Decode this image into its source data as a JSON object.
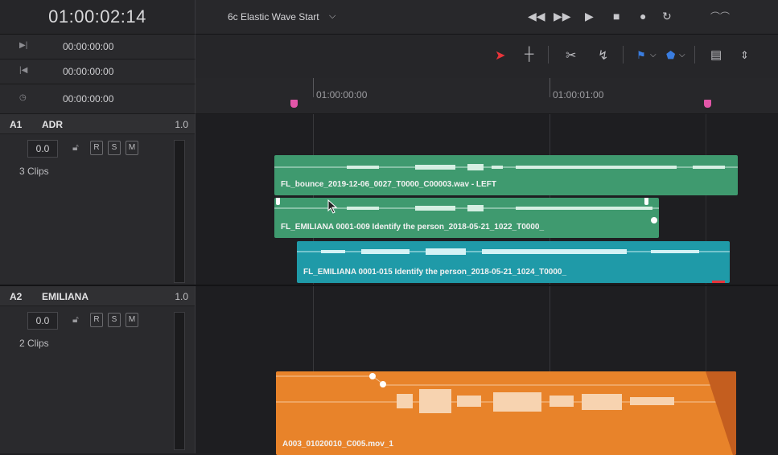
{
  "timecode": "01:00:02:14",
  "tc_rows": [
    {
      "icon": "in-point-icon",
      "glyph": "▶|",
      "value": "00:00:00:00"
    },
    {
      "icon": "out-point-icon",
      "glyph": "|◀",
      "value": "00:00:00:00"
    },
    {
      "icon": "clock-icon",
      "glyph": "◷",
      "value": "00:00:00:00"
    }
  ],
  "timeline_name": "6c Elastic Wave Start",
  "ruler": {
    "labels": [
      "01:00:00:00",
      "01:00:01:00"
    ]
  },
  "tracks": [
    {
      "id": "A1",
      "name": "ADR",
      "level": "1.0",
      "volume": "0.0",
      "clips": "3 Clips",
      "buttons": [
        "R",
        "S",
        "M"
      ]
    },
    {
      "id": "A2",
      "name": "EMILIANA",
      "level": "1.0",
      "volume": "0.0",
      "clips": "2 Clips",
      "buttons": [
        "R",
        "S",
        "M"
      ]
    }
  ],
  "clips": [
    {
      "label": "FL_bounce_2019-12-06_0027_T0000_C00003.wav - LEFT",
      "color": "#3f9a6f"
    },
    {
      "label": "FL_EMILIANA 0001-009 Identify the person_2018-05-21_1022_T0000_",
      "color": "#3f9a6f"
    },
    {
      "label": "FL_EMILIANA 0001-015 Identify the person_2018-05-21_1024_T0000_",
      "color": "#1f9aa8"
    },
    {
      "label": "A003_01020010_C005.mov_1",
      "color": "#e8832a"
    }
  ],
  "colors": {
    "marker": "#e256a8",
    "pointer": "#e8343a",
    "flag": "#3a7de0"
  }
}
